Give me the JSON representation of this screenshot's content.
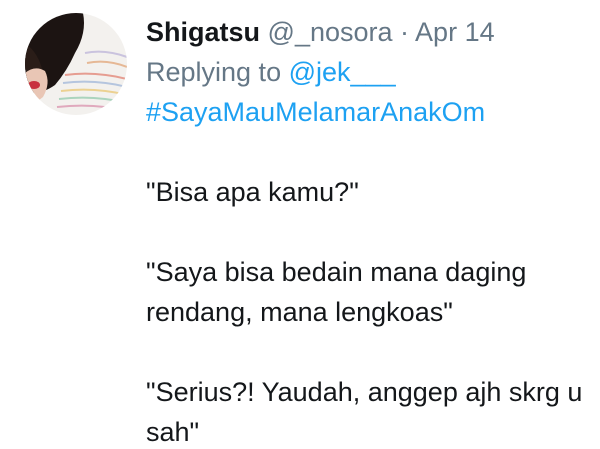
{
  "tweet": {
    "author_name": "Shigatsu",
    "author_handle": "@_nosora",
    "separator": "·",
    "date": "Apr 14",
    "replying_prefix": "Replying to",
    "replying_user": "@jek___",
    "hashtag": "#SayaMauMelamarAnakOm",
    "lines": [
      "\"Bisa apa kamu?\"",
      "\"Saya bisa bedain mana daging",
      "rendang, mana lengkoas\"",
      "\"Serius?! Yaudah, anggep ajh skrg u",
      "sah\""
    ]
  },
  "colors": {
    "link": "#1da1f2",
    "text": "#14171a",
    "muted": "#657786"
  },
  "icons": {
    "avatar": "profile-photo"
  }
}
